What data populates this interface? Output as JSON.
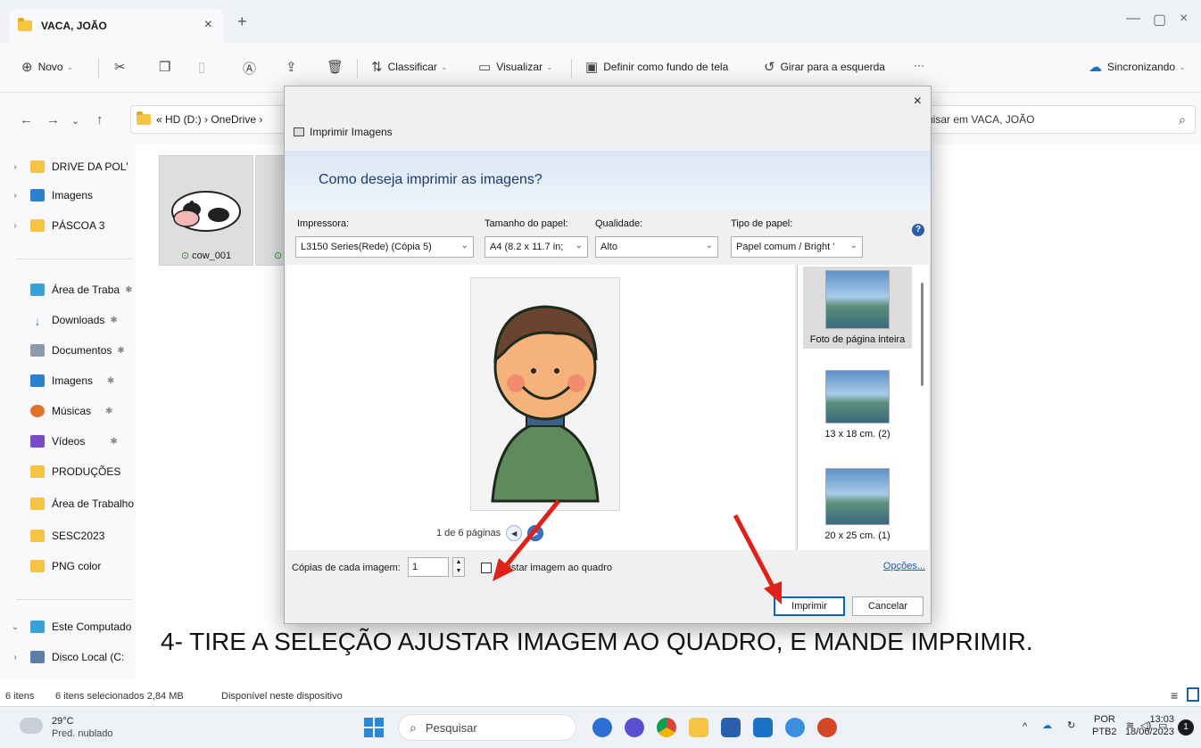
{
  "window": {
    "tab_title": "VACA, JOÃO",
    "tab_close": "×",
    "new_tab": "+",
    "minimize": "—",
    "maximize": "▢",
    "close": "×"
  },
  "toolbar": {
    "new_label": "Novo",
    "sort_label": "Classificar",
    "view_label": "Visualizar",
    "set_background_label": "Definir como fundo de tela",
    "rotate_left_label": "Girar para a esquerda",
    "more_label": "···",
    "sync_label": "Sincronizando"
  },
  "address": {
    "path": "« HD (D:) › OneDrive ›",
    "search_text": "uisar em VACA, JOÃO"
  },
  "sidebar": {
    "items": [
      {
        "label": "DRIVE DA POL'",
        "expand": "›"
      },
      {
        "label": "Imagens",
        "expand": "›"
      },
      {
        "label": "PÁSCOA 3",
        "expand": "›"
      },
      {
        "label": "Área de Traba"
      },
      {
        "label": "Downloads"
      },
      {
        "label": "Documentos"
      },
      {
        "label": "Imagens"
      },
      {
        "label": "Músicas"
      },
      {
        "label": "Vídeos"
      },
      {
        "label": "PRODUÇÕES"
      },
      {
        "label": "Área de Trabalho"
      },
      {
        "label": "SESC2023"
      },
      {
        "label": "PNG color"
      },
      {
        "label": "Este Computado",
        "expand": "⌄"
      },
      {
        "label": "Disco Local (C:",
        "expand": "›"
      }
    ],
    "pin": "✱"
  },
  "content": {
    "thumb1_caption": "cow_001",
    "check": "⊙"
  },
  "dialog": {
    "title": "Imprimir Imagens",
    "close": "×",
    "question": "Como deseja imprimir as imagens?",
    "printer_label": "Impressora:",
    "printer_value": "L3150 Series(Rede) (Cópia 5)",
    "paper_size_label": "Tamanho do papel:",
    "paper_size_value": "A4 (8.2 x 11.7 in;",
    "quality_label": "Qualidade:",
    "quality_value": "Alto",
    "paper_type_label": "Tipo de papel:",
    "paper_type_value": "Papel comum / Bright '",
    "help": "?",
    "page_info": "1 de 6 páginas",
    "layouts": [
      {
        "label": "Foto de página inteira"
      },
      {
        "label": "13 x 18 cm. (2)"
      },
      {
        "label": "20 x 25 cm. (1)"
      }
    ],
    "copies_label": "Cópias de cada imagem:",
    "copies_value": "1",
    "fit_label": "Ajustar imagem ao quadro",
    "options_link": "Opções...",
    "print_button": "Imprimir",
    "cancel_button": "Cancelar"
  },
  "instruction": "4- TIRE A SELEÇÃO AJUSTAR IMAGEM AO QUADRO, E MANDE IMPRIMIR.",
  "statusbar": {
    "count": "6 itens",
    "selected": "6 itens selecionados 2,84 MB",
    "availability": "Disponível neste dispositivo"
  },
  "taskbar": {
    "temperature": "29°C",
    "weather": "Pred. nublado",
    "search_placeholder": "Pesquisar",
    "language": "POR",
    "keyboard": "PTB2",
    "time": "13:03",
    "date": "18/06/2023",
    "notifications": "1"
  },
  "colors": {
    "accent": "#0a64c8",
    "arrow": "#e0201a",
    "folder": "#f6c443"
  }
}
